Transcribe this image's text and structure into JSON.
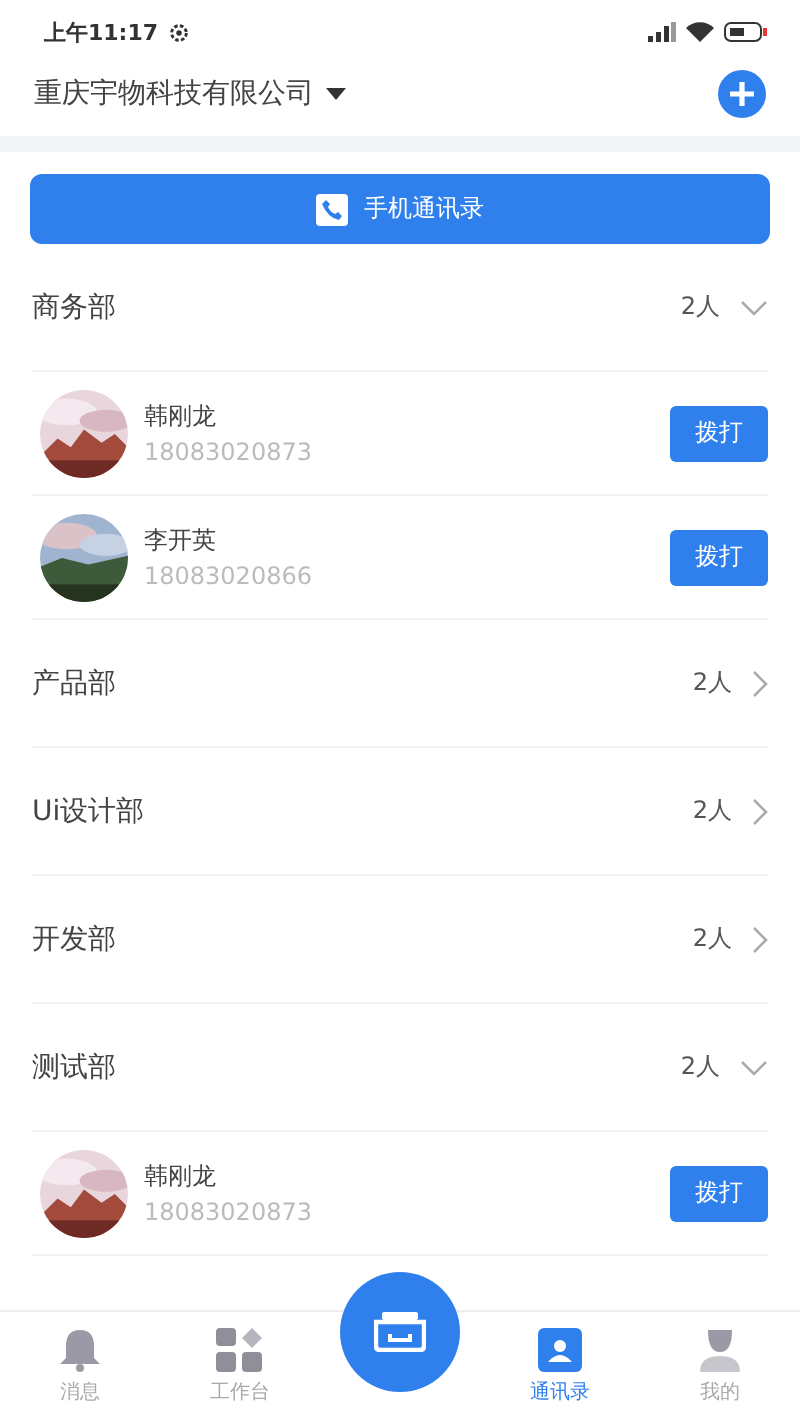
{
  "status_bar": {
    "time": "上午11:17"
  },
  "header": {
    "company": "重庆宇物科技有限公司"
  },
  "phone_contacts_button": {
    "label": "手机通讯录"
  },
  "departments": [
    {
      "name": "商务部",
      "count": "2人",
      "expanded": true,
      "members": [
        {
          "name": "韩刚龙",
          "phone": "18083020873",
          "call_label": "拨打"
        },
        {
          "name": "李开英",
          "phone": "18083020866",
          "call_label": "拨打"
        }
      ]
    },
    {
      "name": "产品部",
      "count": "2人",
      "expanded": false
    },
    {
      "name": "Ui设计部",
      "count": "2人",
      "expanded": false
    },
    {
      "name": "开发部",
      "count": "2人",
      "expanded": false
    },
    {
      "name": "测试部",
      "count": "2人",
      "expanded": true,
      "members": [
        {
          "name": "韩刚龙",
          "phone": "18083020873",
          "call_label": "拨打"
        }
      ]
    }
  ],
  "tab_bar": [
    {
      "kind": "bell",
      "label": "消息",
      "selected": false
    },
    {
      "kind": "grid",
      "label": "工作台",
      "selected": false
    },
    {
      "kind": "fab"
    },
    {
      "kind": "contacts",
      "label": "通讯录",
      "selected": true
    },
    {
      "kind": "person",
      "label": "我的",
      "selected": false
    }
  ]
}
